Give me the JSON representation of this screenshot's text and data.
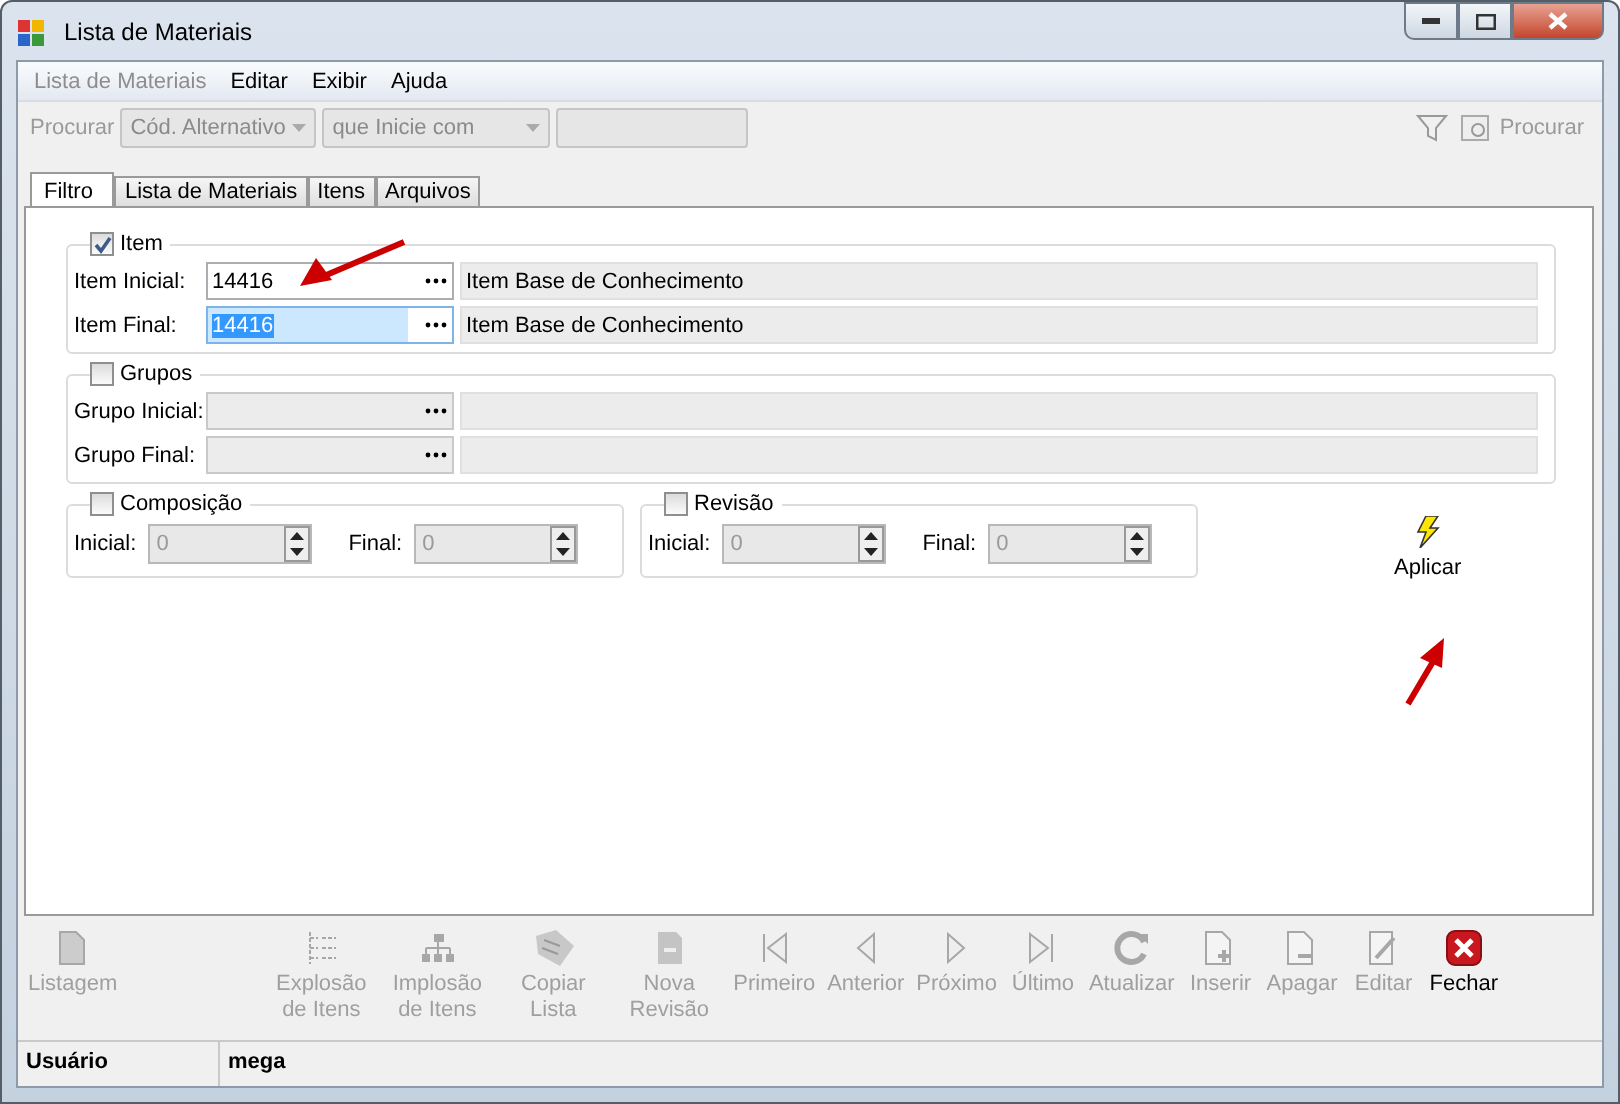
{
  "window": {
    "title": "Lista de Materiais"
  },
  "menu": [
    {
      "label": "Lista de Materiais",
      "disabled": true
    },
    {
      "label": "Editar",
      "disabled": false
    },
    {
      "label": "Exibir",
      "disabled": false
    },
    {
      "label": "Ajuda",
      "disabled": false
    }
  ],
  "search": {
    "label": "Procurar",
    "field": "Cód. Alternativo",
    "mode": "que Inicie com",
    "button": "Procurar"
  },
  "tabs": [
    {
      "label": "Filtro",
      "selected": true
    },
    {
      "label": "Lista de Materiais",
      "selected": false
    },
    {
      "label": "Itens",
      "selected": false
    },
    {
      "label": "Arquivos",
      "selected": false
    }
  ],
  "ranges": [
    {
      "title": "Item",
      "checked": true,
      "fields": [
        {
          "label": "Item Inicial:",
          "value": "14416",
          "description": "Item Base de Conhecimento",
          "selected": false,
          "disabled": false
        },
        {
          "label": "Item Final:",
          "value": "14416",
          "description": "Item Base de Conhecimento",
          "selected": true,
          "disabled": false
        }
      ]
    },
    {
      "title": "Grupos",
      "checked": false,
      "fields": [
        {
          "label": "Grupo Inicial:",
          "selected": false,
          "disabled": true
        },
        {
          "label": "Grupo Final:",
          "selected": false,
          "disabled": true
        }
      ]
    }
  ],
  "spinner_groups": [
    {
      "title": "Composição",
      "checked": false,
      "initial_label": "Inicial:",
      "initial_value": "0",
      "final_label": "Final:",
      "final_value": "0"
    },
    {
      "title": "Revisão",
      "checked": false,
      "initial_label": "Inicial:",
      "initial_value": "0",
      "final_label": "Final:",
      "final_value": "0"
    }
  ],
  "apply_button": "Aplicar",
  "toolbar": [
    {
      "label": "Listagem",
      "disabled": true
    },
    {
      "label": "Explosão de Itens",
      "disabled": true
    },
    {
      "label": "Implosão de Itens",
      "disabled": true
    },
    {
      "label": "Copiar Lista",
      "disabled": true
    },
    {
      "label": "Nova Revisão",
      "disabled": true
    },
    {
      "label": "Primeiro",
      "disabled": true
    },
    {
      "label": "Anterior",
      "disabled": true
    },
    {
      "label": "Próximo",
      "disabled": true
    },
    {
      "label": "Último",
      "disabled": true
    },
    {
      "label": "Atualizar",
      "disabled": true
    },
    {
      "label": "Inserir",
      "disabled": true
    },
    {
      "label": "Apagar",
      "disabled": true
    },
    {
      "label": "Editar",
      "disabled": true
    },
    {
      "label": "Fechar",
      "disabled": false
    }
  ],
  "status_bar": [
    {
      "text": "Usuário"
    },
    {
      "text": "mega"
    }
  ]
}
